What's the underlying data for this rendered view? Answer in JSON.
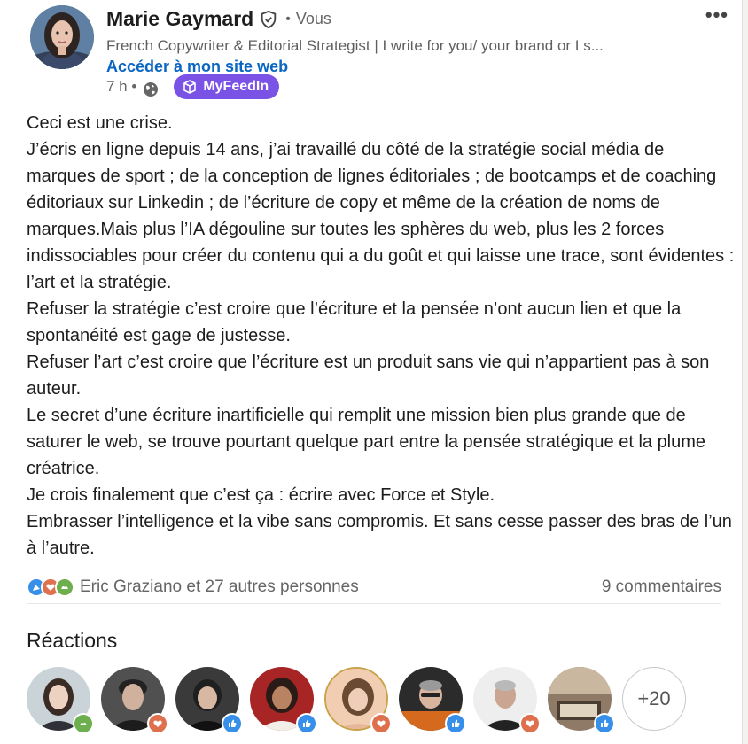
{
  "post": {
    "author_name": "Marie Gaymard",
    "separator": "•",
    "you_label": "Vous",
    "headline": "French Copywriter & Editorial Strategist | I write for you/ your brand or I s...",
    "website_link": "Accéder à mon site web",
    "time": "7 h •",
    "badge_label": "MyFeedIn",
    "more_label": "•••",
    "paragraphs": [
      "Ceci est une crise.",
      "J’écris en ligne depuis 14 ans, j’ai travaillé du côté de la stratégie social média de marques de sport ; de la conception de lignes éditoriales ; de bootcamps et de coaching éditoriaux sur Linkedin ; de l’écriture de copy et même de la création de noms de marques.Mais plus l’IA dégouline sur toutes les sphères du web, plus les 2 forces indissociables pour créer du contenu qui a du goût et qui laisse une trace, sont évidentes : l’art et la stratégie.",
      "Refuser la stratégie c’est croire que l’écriture et la pensée n’ont aucun lien et que la spontanéité est gage de justesse.",
      "Refuser l’art c’est croire que l’écriture est un produit sans vie qui n’appartient pas à son auteur.",
      "Le secret d’une écriture inartificielle qui remplit une mission bien plus grande que de saturer le web, se trouve pourtant quelque part entre la pensée stratégique et la plume créatrice.",
      "Je crois finalement que c’est ça : écrire avec Force et Style.",
      "Embrasser l’intelligence et la vibe sans compromis. Et sans cesse passer des bras de l’un à l’autre."
    ],
    "reaction_icons": [
      "celebrate-icon",
      "love-icon",
      "support-icon"
    ],
    "reactions_summary": "Eric Graziano et 27 autres personnes",
    "comments_count": "9 commentaires"
  },
  "reactions": {
    "title": "Réactions",
    "people": [
      {
        "reaction": "support-icon"
      },
      {
        "reaction": "love-icon"
      },
      {
        "reaction": "like-icon"
      },
      {
        "reaction": "like-icon"
      },
      {
        "reaction": "love-icon"
      },
      {
        "reaction": "like-icon"
      },
      {
        "reaction": "love-icon"
      },
      {
        "reaction": "like-icon"
      }
    ],
    "more_count": "+20"
  },
  "colors": {
    "link": "#0a66c2",
    "badge": "#7a52e6",
    "like": "#378fe9",
    "love": "#df704d",
    "support": "#6dae4f"
  }
}
